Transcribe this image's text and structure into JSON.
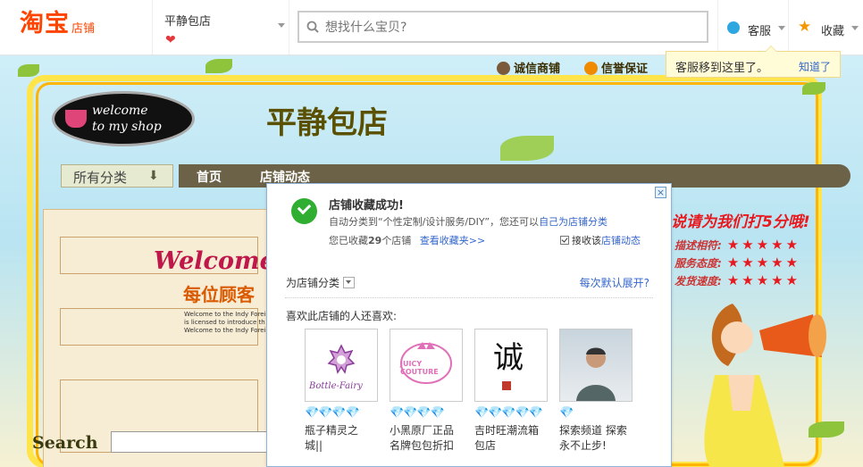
{
  "header": {
    "logo": "淘宝",
    "logo_sub": "店铺",
    "shop_name": "平静包店",
    "search_placeholder": "想找什么宝贝?",
    "kefu_label": "客服",
    "fav_label": "收藏",
    "tip_text": "客服移到这里了。",
    "tip_link": "知道了"
  },
  "banner": {
    "sign_line1": "welcome",
    "sign_line2": "to my shop",
    "shop_title": "平静包店",
    "trust1": "诚信商铺",
    "trust2": "信誉保证",
    "all_categories": "所有分类",
    "nav": [
      "首页",
      "店铺动态"
    ],
    "welcome_text": "Welcome t",
    "mei_text": "每位顾客",
    "small_lines": [
      "Welcome to the Indy Foreign",
      "is licensed to introduce th",
      "Welcome to the Indy Foreign"
    ],
    "promo": "说请为我们打5分哦!",
    "ratings": [
      {
        "label": "描述相符:",
        "stars": 5
      },
      {
        "label": "服务态度:",
        "stars": 5
      },
      {
        "label": "发货速度:",
        "stars": 5
      }
    ],
    "search_art": "Search"
  },
  "dialog": {
    "close": "×",
    "title": "店铺收藏成功!",
    "line1_prefix": "自动分类到“个性定制/设计服务/DIY”，您还可以",
    "line1_link": "自己为店铺分类",
    "line2_prefix": "您已收藏",
    "line2_count": "29",
    "line2_suffix": "个店铺",
    "line2_link": "查看收藏夹>>",
    "checkbox_label": "接收该",
    "checkbox_link": "店铺动态",
    "category_label": "为店铺分类",
    "expand_link": "每次默认展开?",
    "like_label": "喜欢此店铺的人还喜欢:",
    "recommendations": [
      {
        "name": "瓶子精灵之城||",
        "diamonds": "💎💎💎💎",
        "img_text": "Bottle-Fairy"
      },
      {
        "name": "小黑原厂正品名牌包包折扣",
        "diamonds": "💎💎💎💎",
        "img_text": "JUICY COUTURE"
      },
      {
        "name": "吉时旺潮流箱包店",
        "diamonds": "💎💎💎💎💎",
        "img_text": "诚"
      },
      {
        "name": "探索频道 探索永不止步!",
        "diamonds": "💎",
        "img_text": ""
      }
    ]
  }
}
